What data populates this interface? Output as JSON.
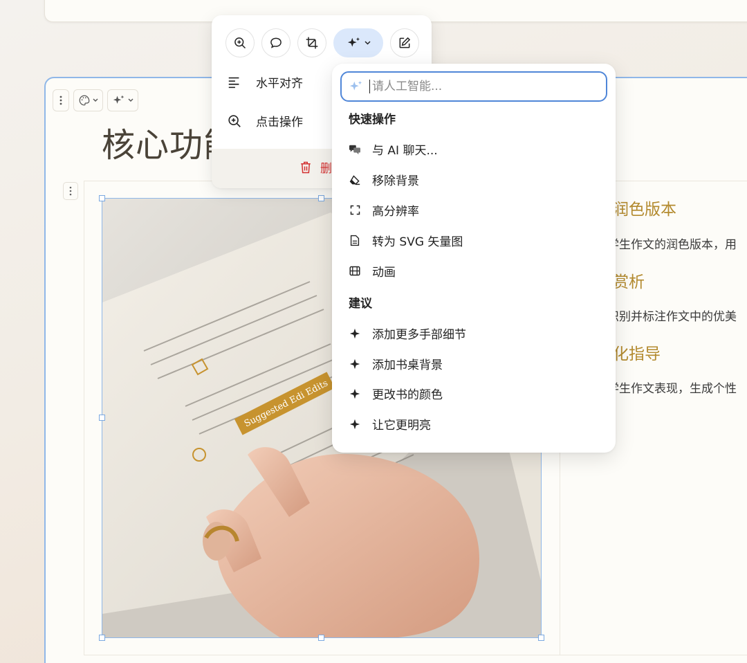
{
  "slide": {
    "title": "核心功能"
  },
  "right_column": {
    "items": [
      {
        "heading": "润色版本",
        "text": "学生作文的润色版本，用"
      },
      {
        "heading": "赏析",
        "text": "识别并标注作文中的优美"
      },
      {
        "heading": "化指导",
        "text": "学生作文表现，生成个性"
      }
    ]
  },
  "image_toolbar": {
    "buttons": [
      "zoom-in",
      "comment",
      "crop",
      "ai",
      "edit"
    ],
    "menu": [
      {
        "label": "水平对齐",
        "icon": "align-left-icon"
      },
      {
        "label": "点击操作",
        "icon": "zoom-in-icon"
      }
    ],
    "delete_label": "删除"
  },
  "ai_menu": {
    "placeholder": "请人工智能...",
    "quick_title": "快速操作",
    "quick_actions": [
      {
        "label": "与 AI 聊天...",
        "icon": "chat-icon"
      },
      {
        "label": "移除背景",
        "icon": "eraser-icon"
      },
      {
        "label": "高分辨率",
        "icon": "expand-icon"
      },
      {
        "label": "转为 SVG 矢量图",
        "icon": "file-icon"
      },
      {
        "label": "动画",
        "icon": "film-icon"
      }
    ],
    "suggest_title": "建议",
    "suggestions": [
      {
        "label": "添加更多手部细节",
        "icon": "sparkle-icon"
      },
      {
        "label": "添加书桌背景",
        "icon": "sparkle-icon"
      },
      {
        "label": "更改书的颜色",
        "icon": "sparkle-icon"
      },
      {
        "label": "让它更明亮",
        "icon": "sparkle-icon"
      }
    ]
  },
  "image": {
    "banner_text": "Suggested Edi Edits"
  },
  "colors": {
    "accent_blue": "#4f86d8",
    "heading_gold": "#b38a2e",
    "delete_red": "#d32f2f"
  }
}
